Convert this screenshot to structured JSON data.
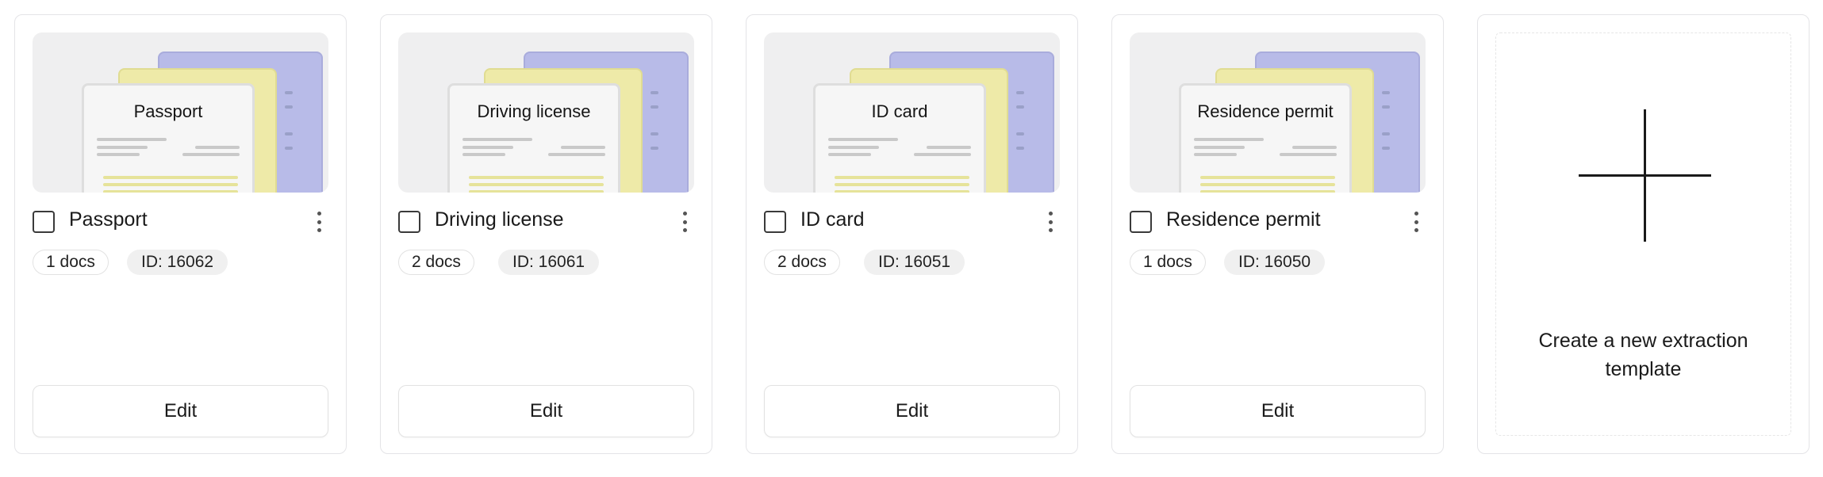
{
  "templates": [
    {
      "title": "Passport",
      "thumb_title": "Passport",
      "docs": "1 docs",
      "id": "ID: 16062",
      "edit_label": "Edit"
    },
    {
      "title": "Driving license",
      "thumb_title": "Driving license",
      "docs": "2 docs",
      "id": "ID: 16061",
      "edit_label": "Edit"
    },
    {
      "title": "ID card",
      "thumb_title": "ID card",
      "docs": "2 docs",
      "id": "ID: 16051",
      "edit_label": "Edit"
    },
    {
      "title": "Residence permit",
      "thumb_title": "Residence permit",
      "docs": "1 docs",
      "id": "ID: 16050",
      "edit_label": "Edit"
    }
  ],
  "create": {
    "label": "Create a new extraction template",
    "icon": "plus-icon"
  },
  "icons": {
    "checkbox": "checkbox-icon",
    "menu": "more-vertical-icon"
  },
  "colors": {
    "card_border": "#e4e4e7",
    "doc_blue": "#b8bbe8",
    "doc_yellow": "#eeeaa8",
    "text": "#1a1a1a"
  }
}
